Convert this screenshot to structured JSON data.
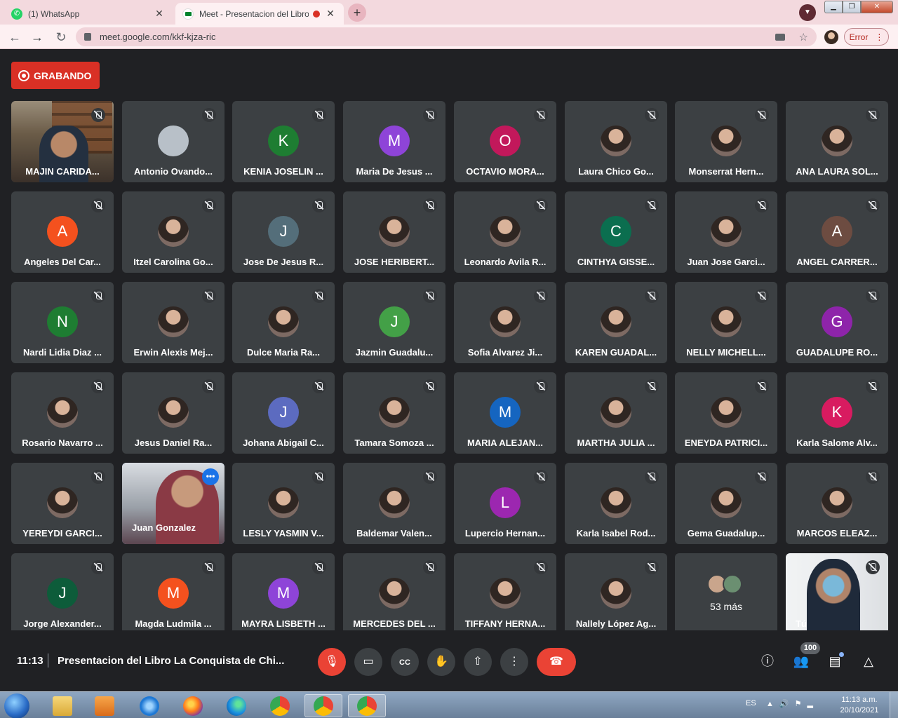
{
  "browser": {
    "tabs": [
      {
        "title": "(1) WhatsApp",
        "icon": "whatsapp-icon",
        "active": false
      },
      {
        "title": "Meet - Presentacion del Libro",
        "icon": "google-meet-icon",
        "active": true
      }
    ],
    "new_tab_label": "+",
    "url": "meet.google.com/kkf-kjza-ric",
    "error_label": "Error"
  },
  "meet": {
    "recording_label": "GRABANDO",
    "clock": "11:13",
    "meeting_title": "Presentacion del Libro La Conquista de Chi...",
    "people_count": "100",
    "participants": [
      {
        "name": "MAJIN CARIDA...",
        "kind": "video-room"
      },
      {
        "name": "Antonio Ovando...",
        "kind": "photo",
        "color": "#b8c0c8"
      },
      {
        "name": "KENIA JOSELIN ...",
        "kind": "letter",
        "letter": "K",
        "color": "#1e7d32"
      },
      {
        "name": "Maria De Jesus ...",
        "kind": "letter",
        "letter": "M",
        "color": "#8e44d8"
      },
      {
        "name": "OCTAVIO MORA...",
        "kind": "letter",
        "letter": "O",
        "color": "#c2185b"
      },
      {
        "name": "Laura Chico Go...",
        "kind": "photo"
      },
      {
        "name": "Monserrat Hern...",
        "kind": "photo"
      },
      {
        "name": "ANA LAURA SOL...",
        "kind": "photo"
      },
      {
        "name": "Angeles Del Car...",
        "kind": "letter",
        "letter": "A",
        "color": "#f4511e"
      },
      {
        "name": "Itzel Carolina Go...",
        "kind": "photo"
      },
      {
        "name": "Jose De Jesus R...",
        "kind": "letter",
        "letter": "J",
        "color": "#546e7a"
      },
      {
        "name": "JOSE HERIBERT...",
        "kind": "photo"
      },
      {
        "name": "Leonardo Avila R...",
        "kind": "photo"
      },
      {
        "name": "CINTHYA GISSE...",
        "kind": "letter",
        "letter": "C",
        "color": "#0b6e4f"
      },
      {
        "name": "Juan Jose Garci...",
        "kind": "photo"
      },
      {
        "name": "ANGEL CARRER...",
        "kind": "letter",
        "letter": "A",
        "color": "#6d4c41"
      },
      {
        "name": "Nardi Lidia Diaz ...",
        "kind": "letter",
        "letter": "N",
        "color": "#1e7d32"
      },
      {
        "name": "Erwin Alexis Mej...",
        "kind": "photo"
      },
      {
        "name": "Dulce Maria Ra...",
        "kind": "photo"
      },
      {
        "name": "Jazmin Guadalu...",
        "kind": "letter",
        "letter": "J",
        "color": "#43a047"
      },
      {
        "name": "Sofia Alvarez Ji...",
        "kind": "photo"
      },
      {
        "name": "KAREN GUADAL...",
        "kind": "photo"
      },
      {
        "name": "NELLY MICHELL...",
        "kind": "photo"
      },
      {
        "name": "GUADALUPE RO...",
        "kind": "letter",
        "letter": "G",
        "color": "#8e24aa"
      },
      {
        "name": "Rosario Navarro ...",
        "kind": "photo"
      },
      {
        "name": "Jesus Daniel Ra...",
        "kind": "photo"
      },
      {
        "name": "Johana Abigail C...",
        "kind": "letter",
        "letter": "J",
        "color": "#5c6bc0"
      },
      {
        "name": "Tamara Somoza ...",
        "kind": "photo"
      },
      {
        "name": "MARIA ALEJAN...",
        "kind": "letter",
        "letter": "M",
        "color": "#1565c0"
      },
      {
        "name": "MARTHA JULIA ...",
        "kind": "photo"
      },
      {
        "name": "ENEYDA PATRICI...",
        "kind": "photo"
      },
      {
        "name": "Karla Salome Alv...",
        "kind": "letter",
        "letter": "K",
        "color": "#d81b60"
      },
      {
        "name": "YEREYDI GARCI...",
        "kind": "photo"
      },
      {
        "name": "Juan Gonzalez",
        "kind": "video-church"
      },
      {
        "name": "LESLY YASMIN V...",
        "kind": "photo"
      },
      {
        "name": "Baldemar Valen...",
        "kind": "photo"
      },
      {
        "name": "Lupercio Hernan...",
        "kind": "letter",
        "letter": "L",
        "color": "#9c27b0"
      },
      {
        "name": "Karla Isabel Rod...",
        "kind": "photo"
      },
      {
        "name": "Gema Guadalup...",
        "kind": "photo"
      },
      {
        "name": "MARCOS ELEAZ...",
        "kind": "photo"
      },
      {
        "name": "Jorge Alexander...",
        "kind": "letter",
        "letter": "J",
        "color": "#0d5c3a"
      },
      {
        "name": "Magda Ludmila ...",
        "kind": "letter",
        "letter": "M",
        "color": "#f4511e"
      },
      {
        "name": "MAYRA LISBETH ...",
        "kind": "letter",
        "letter": "M",
        "color": "#8e44d8"
      },
      {
        "name": "MERCEDES DEL ...",
        "kind": "photo"
      },
      {
        "name": "TIFFANY HERNA...",
        "kind": "photo"
      },
      {
        "name": "Nallely López Ag...",
        "kind": "photo"
      },
      {
        "name": "53 más",
        "kind": "overflow"
      },
      {
        "name": "Tú",
        "kind": "video-self"
      }
    ]
  },
  "taskbar": {
    "language": "ES",
    "time": "11:13 a.m.",
    "date": "20/10/2021"
  },
  "colors": {
    "meet_bg": "#202124",
    "tile_bg": "#3c4043",
    "recording_red": "#d93025",
    "leave_red": "#ea4335",
    "speaking_blue": "#8ab4f8"
  }
}
